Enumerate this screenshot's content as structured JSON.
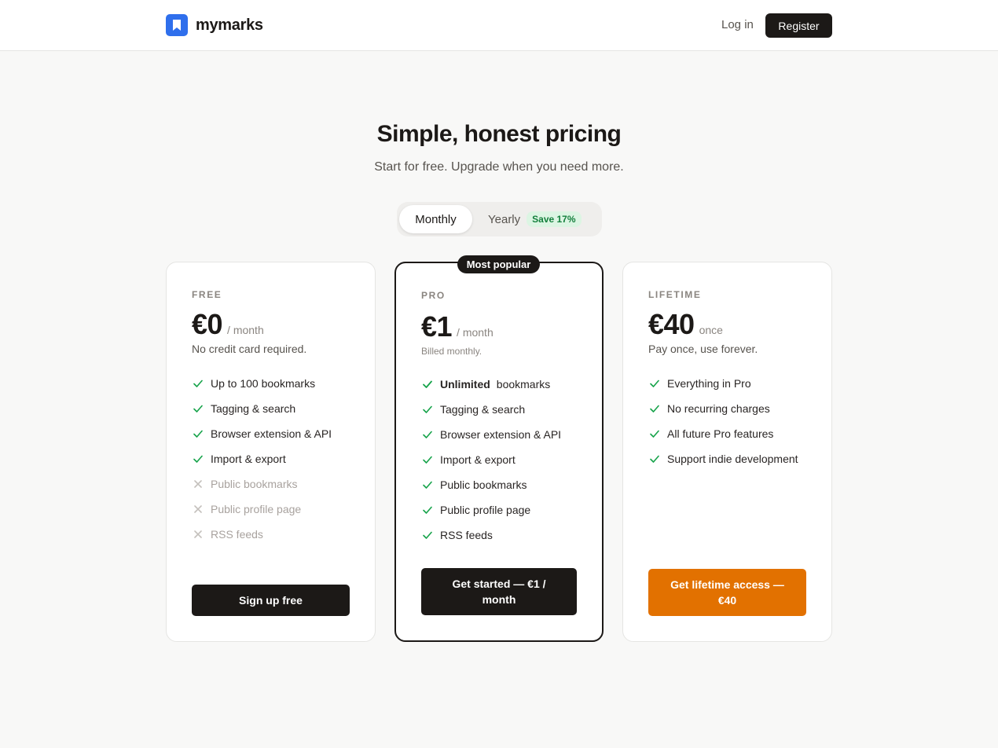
{
  "header": {
    "brand": "mymarks",
    "login_label": "Log in",
    "register_label": "Register",
    "brand_color": "#2f6fec"
  },
  "hero": {
    "title": "Simple, honest pricing",
    "subtitle": "Start for free. Upgrade when you need more."
  },
  "billing_toggle": {
    "monthly_label": "Monthly",
    "yearly_label": "Yearly",
    "save_badge": "Save 17%",
    "selected": "Monthly"
  },
  "plans": {
    "free": {
      "label": "FREE",
      "price": "€0",
      "period": "/ month",
      "note": "No credit card required.",
      "features": [
        {
          "text": "Up to 100 bookmarks",
          "included": true
        },
        {
          "text": "Tagging & search",
          "included": true
        },
        {
          "text": "Browser extension & API",
          "included": true
        },
        {
          "text": "Import & export",
          "included": true
        },
        {
          "text": "Public bookmarks",
          "included": false
        },
        {
          "text": "Public profile page",
          "included": false
        },
        {
          "text": "RSS feeds",
          "included": false
        }
      ],
      "cta": "Sign up free"
    },
    "pro": {
      "badge": "Most popular",
      "label": "PRO",
      "price": "€1",
      "period": "/ month",
      "note": "Billed monthly.",
      "first_feature_bold": "Unlimited",
      "first_feature_rest": "bookmarks",
      "features": [
        {
          "text": "Tagging & search",
          "included": true
        },
        {
          "text": "Browser extension & API",
          "included": true
        },
        {
          "text": "Import & export",
          "included": true
        },
        {
          "text": "Public bookmarks",
          "included": true
        },
        {
          "text": "Public profile page",
          "included": true
        },
        {
          "text": "RSS feeds",
          "included": true
        }
      ],
      "cta_line1": "Get started — €1 /",
      "cta_line2": "month"
    },
    "lifetime": {
      "label": "LIFETIME",
      "price": "€40",
      "period": "once",
      "note": "Pay once, use forever.",
      "features": [
        {
          "text": "Everything in Pro",
          "included": true
        },
        {
          "text": "No recurring charges",
          "included": true
        },
        {
          "text": "All future Pro features",
          "included": true
        },
        {
          "text": "Support indie development",
          "included": true
        }
      ],
      "cta_line1": "Get lifetime access —",
      "cta_line2": "€40",
      "cta_color": "#e27100"
    }
  },
  "colors": {
    "check": "#16a34a",
    "cross": "#c4c0bc",
    "dark": "#1c1917"
  }
}
